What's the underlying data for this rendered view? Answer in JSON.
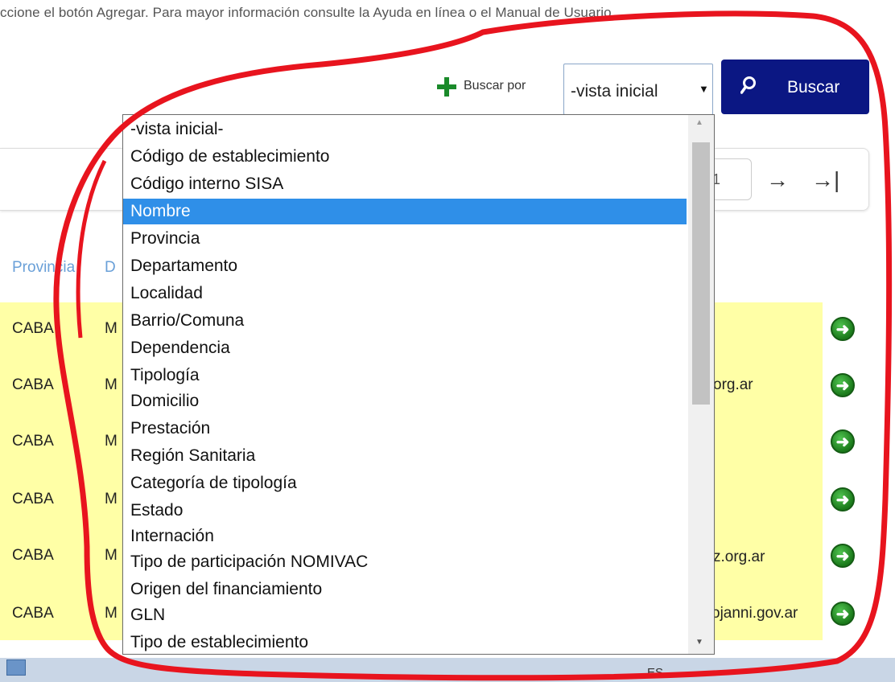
{
  "info_line": "ccione el botón Agregar. Para mayor información consulte la Ayuda en línea o el Manual de Usuario.",
  "search": {
    "label": "Buscar por",
    "selected_value": "-vista inicial",
    "button_label": "Buscar"
  },
  "pager": {
    "page_value": "1"
  },
  "table": {
    "headers": [
      "Provincia",
      "D"
    ],
    "rows": [
      {
        "provincia": "CABA",
        "dep": "M",
        "mail": ""
      },
      {
        "provincia": "CABA",
        "dep": "M",
        "mail": "org.ar"
      },
      {
        "provincia": "CABA",
        "dep": "M",
        "mail": ""
      },
      {
        "provincia": "CABA",
        "dep": "M",
        "mail": ""
      },
      {
        "provincia": "CABA",
        "dep": "M",
        "mail": "z.org.ar"
      },
      {
        "provincia": "CABA",
        "dep": "M",
        "mail": "ojanni.gov.ar"
      }
    ]
  },
  "dropdown": {
    "selected_index": 3,
    "options": [
      "-vista inicial-",
      "Código de establecimiento",
      "Código interno SISA",
      "Nombre",
      "Provincia",
      "Departamento",
      "Localidad",
      "Barrio/Comuna",
      "Dependencia",
      "Tipología",
      "Domicilio",
      "Prestación",
      "Región Sanitaria",
      "Categoría de tipología",
      "Estado",
      "Internación",
      "Tipo de participación NOMIVAC",
      "Origen del financiamiento",
      "GLN",
      "Tipo de establecimiento"
    ]
  },
  "taskbar": {
    "language": "ES"
  },
  "colors": {
    "accent_button": "#0b1783",
    "selected_option": "#2f8fe8",
    "row_highlight": "#ffffa6",
    "annotation": "#e8141e"
  },
  "icons": [
    "add-icon",
    "search-icon",
    "next-page-icon",
    "last-page-icon",
    "go-icon"
  ]
}
